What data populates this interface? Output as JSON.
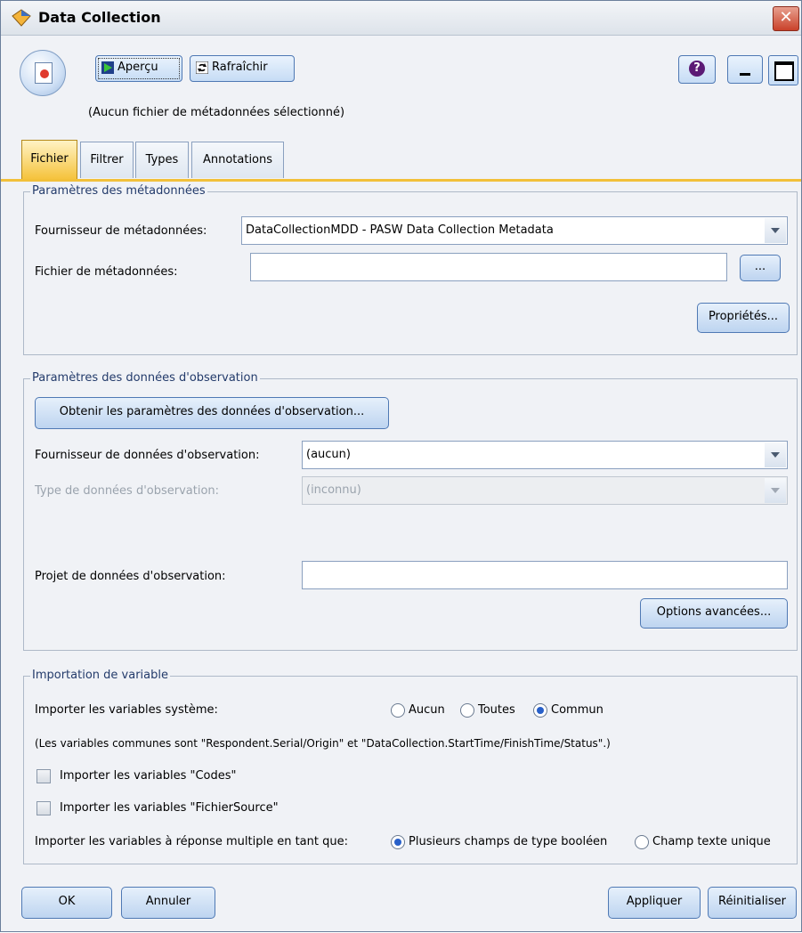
{
  "window": {
    "title": "Data Collection",
    "close_label": "✕"
  },
  "toolbar": {
    "apercu_label": "Aperçu",
    "rafraichir_label": "Rafraîchir",
    "help_label": "?",
    "no_file_text": "(Aucun fichier de métadonnées sélectionné)"
  },
  "tabs": [
    {
      "label": "Fichier",
      "active": true
    },
    {
      "label": "Filtrer",
      "active": false
    },
    {
      "label": "Types",
      "active": false
    },
    {
      "label": "Annotations",
      "active": false
    }
  ],
  "metadata": {
    "legend": "Paramètres des métadonnées",
    "provider_label": "Fournisseur de métadonnées:",
    "provider_value": "DataCollectionMDD - PASW Data Collection Metadata",
    "file_label": "Fichier de métadonnées:",
    "file_value": "",
    "browse_label": "...",
    "properties_label": "Propriétés..."
  },
  "observation": {
    "legend": "Paramètres des données d'observation",
    "get_params_label": "Obtenir les paramètres des données d'observation...",
    "provider_label": "Fournisseur de données d'observation:",
    "provider_value": "(aucun)",
    "type_label": "Type de données d'observation:",
    "type_value": "(inconnu)",
    "project_label": "Projet de données d'observation:",
    "project_value": "",
    "advanced_label": "Options avancées..."
  },
  "import": {
    "legend": "Importation de variable",
    "system_label": "Importer les variables système:",
    "system_options": [
      {
        "label": "Aucun",
        "selected": false
      },
      {
        "label": "Toutes",
        "selected": false
      },
      {
        "label": "Commun",
        "selected": true
      }
    ],
    "common_note": "(Les variables communes sont \"Respondent.Serial/Origin\" et  \"DataCollection.StartTime/FinishTime/Status\".)",
    "codes_label": "Importer les variables \"Codes\"",
    "codes_checked": false,
    "source_label": "Importer les variables \"FichierSource\"",
    "source_checked": false,
    "multi_label": "Importer les variables à réponse multiple en tant que:",
    "multi_options": [
      {
        "label": "Plusieurs champs de type booléen",
        "selected": true
      },
      {
        "label": "Champ texte unique",
        "selected": false
      }
    ]
  },
  "footer": {
    "ok_label": "OK",
    "cancel_label": "Annuler",
    "apply_label": "Appliquer",
    "reset_label": "Réinitialiser"
  },
  "colors": {
    "active_tab": "#f5c33d",
    "button_border": "#4f79b4",
    "legend_text": "#233b6b",
    "close_red": "#c9412a"
  }
}
